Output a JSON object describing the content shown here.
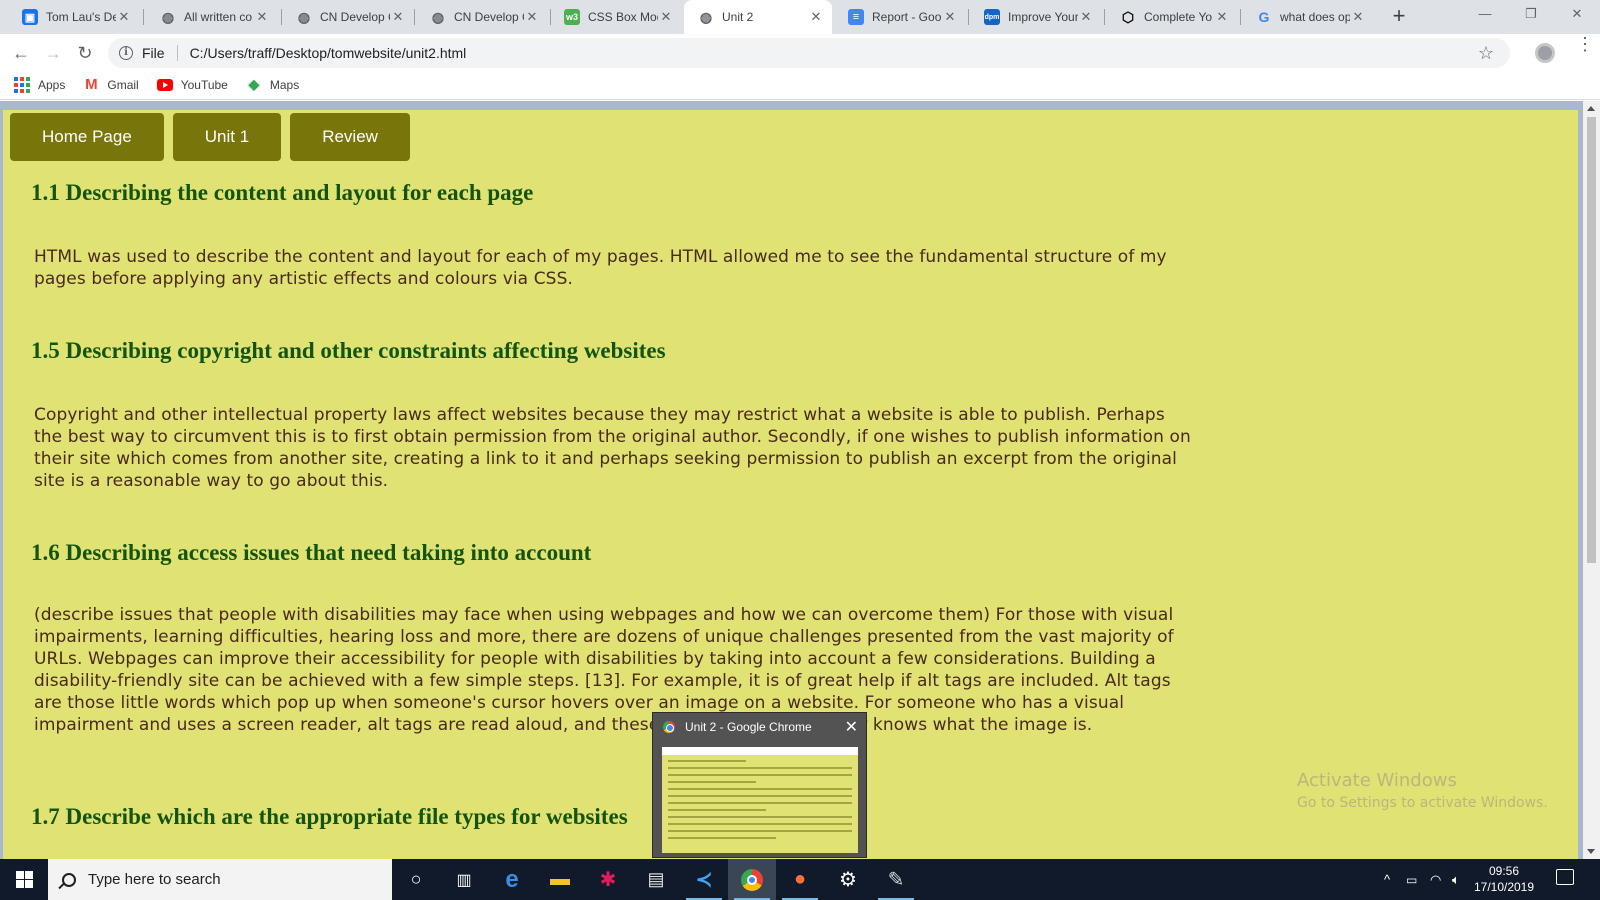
{
  "browser": {
    "tabs": [
      {
        "title": "Tom Lau's De",
        "favicon": "blue-square-icon",
        "color": "#1a73e8"
      },
      {
        "title": "All written co",
        "favicon": "globe-icon",
        "color": "#5f6368"
      },
      {
        "title": "CN Develop C",
        "favicon": "globe-icon",
        "color": "#5f6368"
      },
      {
        "title": "CN Develop C",
        "favicon": "globe-icon",
        "color": "#5f6368"
      },
      {
        "title": "CSS Box Mod",
        "favicon": "w3schools-icon",
        "color": "#4caf50"
      },
      {
        "title": "Unit 2",
        "favicon": "globe-icon",
        "color": "#5f6368",
        "active": true
      },
      {
        "title": "Report - Goo",
        "favicon": "docs-icon",
        "color": "#4285f4"
      },
      {
        "title": "Improve Your",
        "favicon": "dpm-icon",
        "color": "#1565c0"
      },
      {
        "title": "Complete Yo",
        "favicon": "codepen-icon",
        "color": "#111111"
      },
      {
        "title": "what does op",
        "favicon": "google-icon",
        "color": "#4285f4"
      }
    ],
    "address": {
      "scheme_label": "File",
      "url": "C:/Users/traff/Desktop/tomwebsite/unit2.html"
    },
    "bookmarks": [
      {
        "label": "Apps",
        "icon": "apps-grid-icon"
      },
      {
        "label": "Gmail",
        "icon": "gmail-icon"
      },
      {
        "label": "YouTube",
        "icon": "youtube-icon"
      },
      {
        "label": "Maps",
        "icon": "maps-icon"
      }
    ]
  },
  "page": {
    "nav": [
      "Home Page",
      "Unit 1",
      "Review"
    ],
    "sections": [
      {
        "heading": "1.1 Describing the content and layout for each page",
        "body": "HTML was used to describe the content and layout for each of my pages. HTML allowed me to see the fundamental structure of my pages before applying any artistic effects and colours via CSS."
      },
      {
        "heading": "1.5 Describing copyright and other constraints affecting websites",
        "body": "Copyright and other intellectual property laws affect websites because they may restrict what a website is able to publish. Perhaps the best way to circumvent this is to first obtain permission from the original author. Secondly, if one wishes to publish information on their site which comes from another site, creating a link to it and perhaps seeking permission to publish an excerpt from the original site is a reasonable way to go about this."
      },
      {
        "heading": "1.6 Describing access issues that need taking into account",
        "body": "(describe issues that people with disabilities may face when using webpages and how we can overcome them) For those with visual impairments, learning difficulties, hearing loss and more, there are dozens of unique challenges presented from the vast majority of URLs. Webpages can improve their accessibility for people with disabilities by taking into account a few considerations. Building a disability-friendly site can be achieved with a few simple steps. [13]. For example, it is of great help if alt tags are included. Alt tags are those little words which pop up when someone's cursor hovers over an image on a website. For someone who has a visual impairment and uses a screen reader, alt tags are read aloud, and these are the only way a user knows what the image is."
      },
      {
        "heading": "1.7 Describe which are the appropriate file types for websites",
        "body": ""
      }
    ],
    "watermark": {
      "line1": "Activate Windows",
      "line2": "Go to Settings to activate Windows."
    }
  },
  "preview": {
    "title": "Unit 2 - Google Chrome"
  },
  "taskbar": {
    "search_placeholder": "Type here to search",
    "apps": [
      "cortana-icon",
      "task-view-icon",
      "edge-icon",
      "file-explorer-icon",
      "slack-icon",
      "document-icon",
      "vscode-icon",
      "chrome-icon",
      "firefox-icon",
      "settings-icon",
      "paint-icon"
    ],
    "time": "09:56",
    "date": "17/10/2019"
  },
  "colors": {
    "page_bg": "#e0e274",
    "nav_button": "#78750a",
    "heading": "#13550f",
    "body_text": "#4a2a1a"
  }
}
